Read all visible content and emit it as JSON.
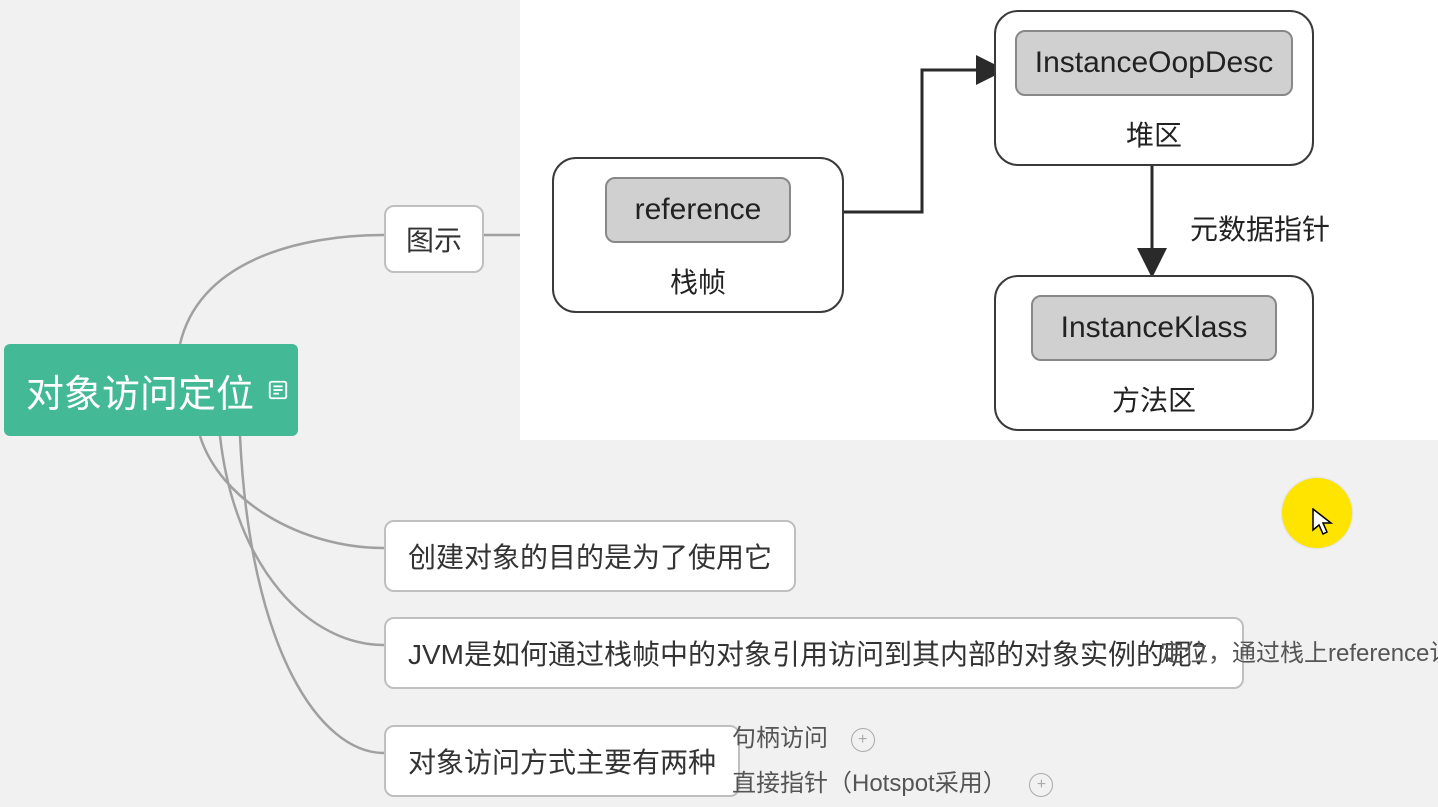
{
  "root": {
    "title": "对象访问定位"
  },
  "nodes": {
    "illustration": "图示",
    "purpose": "创建对象的目的是为了使用它",
    "question": "JVM是如何通过栈帧中的对象引用访问到其内部的对象实例的呢？",
    "question_note": "定位，通过栈上reference访问",
    "two_ways": "对象访问方式主要有两种",
    "way_handle": "句柄访问",
    "way_direct": "直接指针（Hotspot采用）"
  },
  "diagram": {
    "ref_box": "reference",
    "ref_label": "栈帧",
    "oop_box": "InstanceOopDesc",
    "oop_label": "堆区",
    "klass_box": "InstanceKlass",
    "klass_label": "方法区",
    "meta_ptr": "元数据指针"
  }
}
